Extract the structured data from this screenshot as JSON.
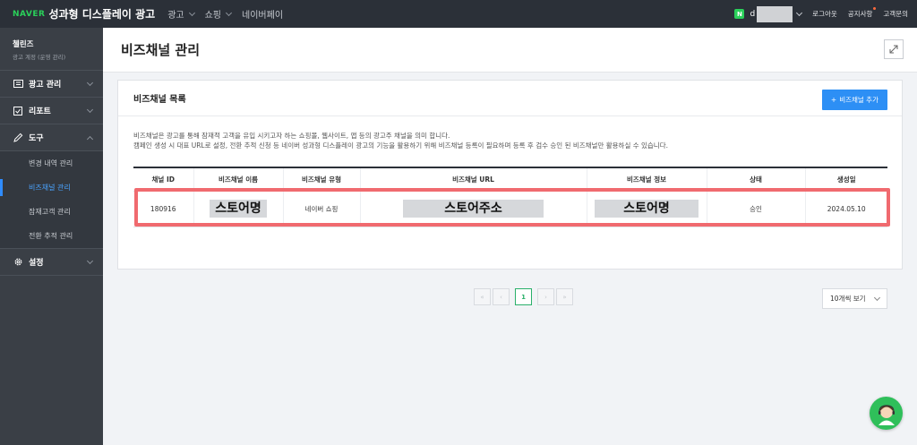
{
  "topbar": {
    "brand_naver": "NAVER",
    "brand_title": "성과형 디스플레이 광고",
    "nav": [
      "광고",
      "쇼핑",
      "네이버페이"
    ],
    "user_badge": "N",
    "user_prefix": "d",
    "links": {
      "logout": "로그아웃",
      "notice": "공지사항",
      "support": "고객문의"
    }
  },
  "sidebar": {
    "account_name": "첼린즈",
    "account_sub": "광고 계정 (운영 관리)",
    "sections": {
      "ad": "광고 관리",
      "report": "리포트",
      "tools": "도구",
      "settings": "설정"
    },
    "tools_items": [
      "변경 내역 관리",
      "비즈채널 관리",
      "잠재고객 관리",
      "전환 추적 관리"
    ],
    "active_item": "비즈채널 관리"
  },
  "page": {
    "title": "비즈채널 관리"
  },
  "card": {
    "title": "비즈채널 목록",
    "add_button": "비즈채널 추가",
    "desc_line1": "비즈채널은 광고를 통해 잠재적 고객을 유입 시키고자 하는 쇼핑몰, 웹사이트, 앱 등의 광고주 채널을 의미 합니다.",
    "desc_line2": "캠페인 생성 시 대표 URL로 설정, 전환 추적 신청 등 네이버 성과형 디스플레이 광고의 기능을 활용하기 위해 비즈채널 등록이 필요하며 등록 후 검수 승인 된 비즈채널만 활용하실 수 있습니다."
  },
  "table": {
    "headers": [
      "채널 ID",
      "비즈채널 이름",
      "비즈채널 유형",
      "비즈채널 URL",
      "비즈채널 정보",
      "상태",
      "생성일"
    ],
    "rows": [
      {
        "id": "180916",
        "name": "스토어명",
        "type": "네이버 쇼핑",
        "url": "스토어주소",
        "info": "스토어명",
        "status": "승인",
        "created": "2024.05.10"
      }
    ]
  },
  "pagination": {
    "current": "1",
    "per_page": "10개씩 보기"
  },
  "colors": {
    "accent": "#2d8ff5",
    "highlight": "#f06a6f",
    "naver_green": "#2ad05a"
  }
}
